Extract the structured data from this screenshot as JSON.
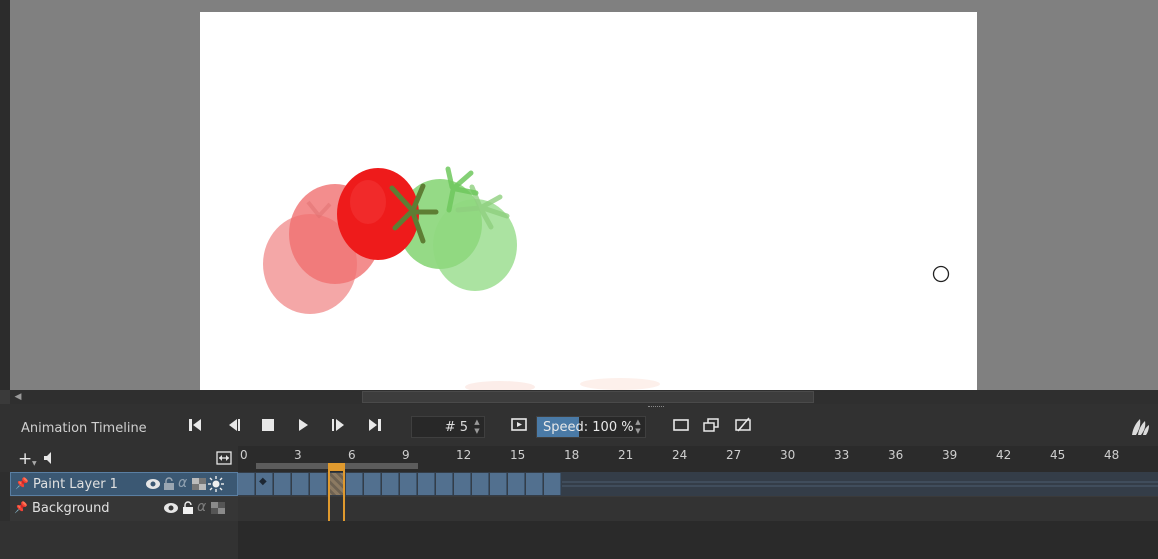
{
  "timeline": {
    "title": "Animation Timeline",
    "current_frame_label": "# 5",
    "speed_prefix": "Speed",
    "speed_suffix": ": 100 %",
    "transport_buttons": [
      "first-frame",
      "previous-frame",
      "stop",
      "play",
      "next-frame",
      "last-frame"
    ],
    "ruler_labels": [
      "0",
      "3",
      "6",
      "9",
      "12",
      "15",
      "18",
      "21",
      "24",
      "27",
      "30",
      "33",
      "36",
      "39",
      "42",
      "45",
      "48"
    ],
    "keyframe_count": 18,
    "layers": [
      {
        "name": "Paint Layer 1",
        "selected": true
      },
      {
        "name": "Background",
        "selected": false
      }
    ],
    "alpha_symbol": "α"
  },
  "colors": {
    "accent": "#4a7aa6",
    "playhead": "#e09a2e",
    "layer_selected": "#3b5873",
    "keyframe_cell": "#52708f",
    "tomato_red": "#ee1b1b",
    "tomato_green": "#6fd45e"
  },
  "icons": {
    "add_layer": "+",
    "audio": "speaker-icon",
    "zoom_fit": "fit-width-icon",
    "krita_logo": "krita-logo"
  }
}
